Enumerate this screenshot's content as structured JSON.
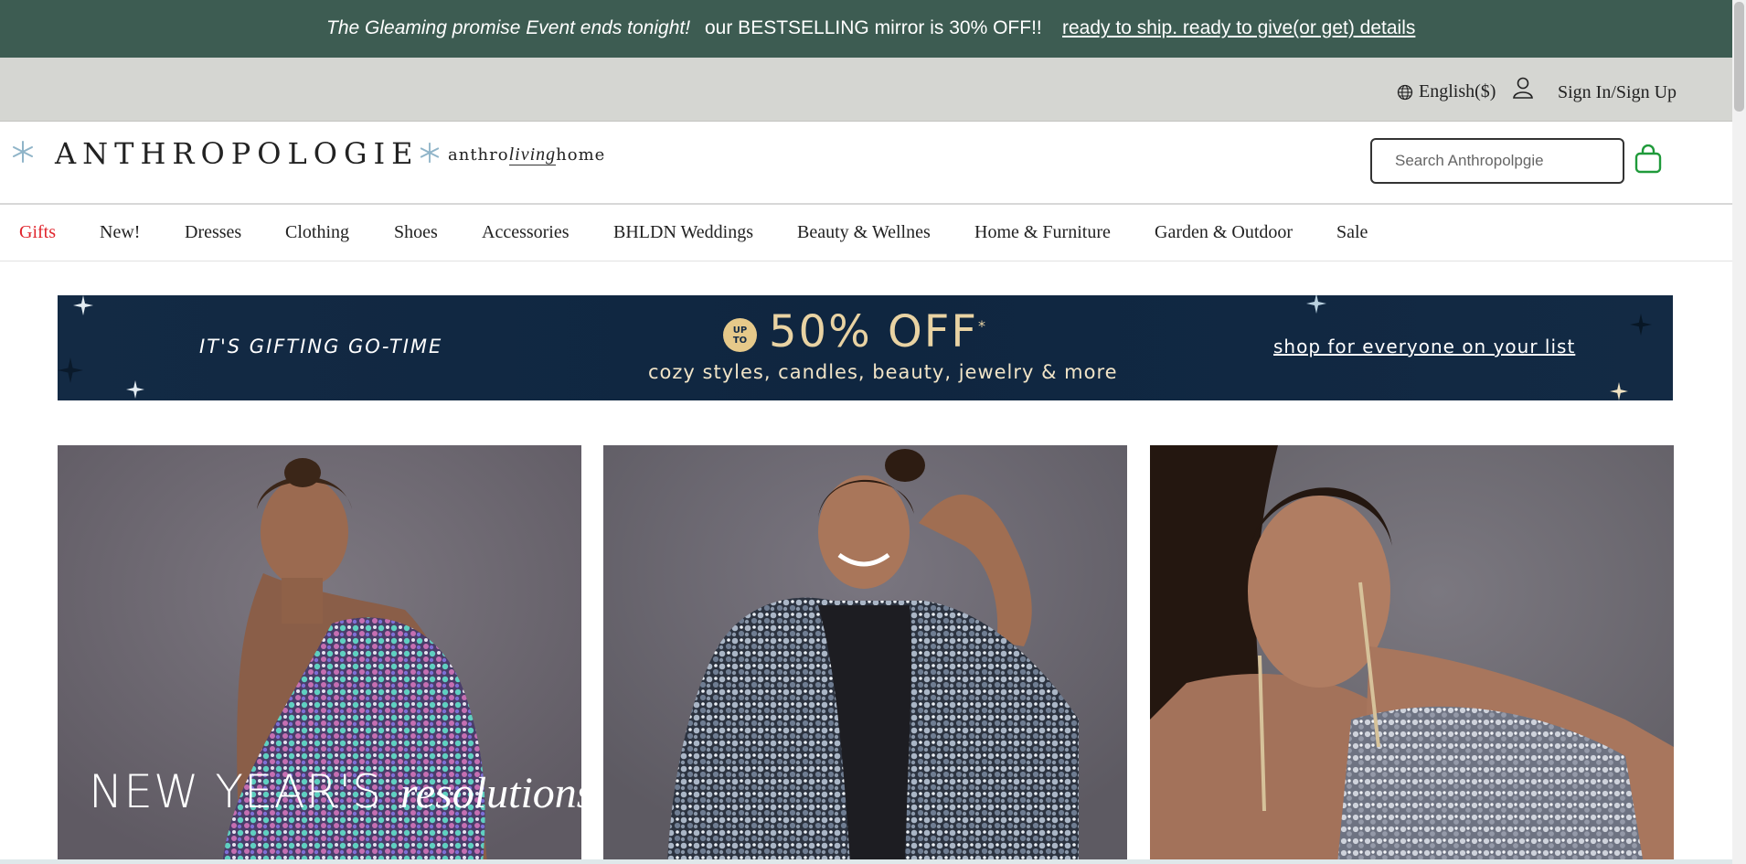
{
  "announcement": {
    "event_text": "The Gleaming promise Event ends tonight!",
    "offer_text": "our BESTSELLING mirror is 30% OFF!!",
    "link_text": "ready to ship. ready to give(or get) details"
  },
  "utility": {
    "language": "English($)",
    "sign_in": "Sign In/Sign Up"
  },
  "brand": {
    "name": "ANTHROPOLOGIE",
    "sub_left": "anthro",
    "sub_script": "living",
    "sub_right": "home"
  },
  "search": {
    "placeholder": "Search Anthropolpgie"
  },
  "nav": {
    "items": [
      "Gifts",
      "New!",
      "Dresses",
      "Clothing",
      "Shoes",
      "Accessories",
      "BHLDN Weddings",
      "Beauty & Wellnes",
      "Home & Furniture",
      "Garden & Outdoor",
      "Sale"
    ]
  },
  "promo": {
    "left_text": "IT'S GIFTING GO-TIME",
    "badge_top": "UP",
    "badge_bottom": "TO",
    "headline": "50% OFF",
    "headline_mark": "*",
    "subline": "cozy styles, candles, beauty, jewelry & more",
    "cta": "shop for everyone on your list"
  },
  "tiles": {
    "overlay_caps": "NEW YEAR'S",
    "overlay_script": "resolutions"
  },
  "colors": {
    "announce_bg": "#3d5c52",
    "utility_bg": "#d5d6d2",
    "promo_bg": "#132a44",
    "gift_red": "#e0242c",
    "bag_green": "#1f9a3a",
    "star_blue": "#8fb4c8"
  }
}
